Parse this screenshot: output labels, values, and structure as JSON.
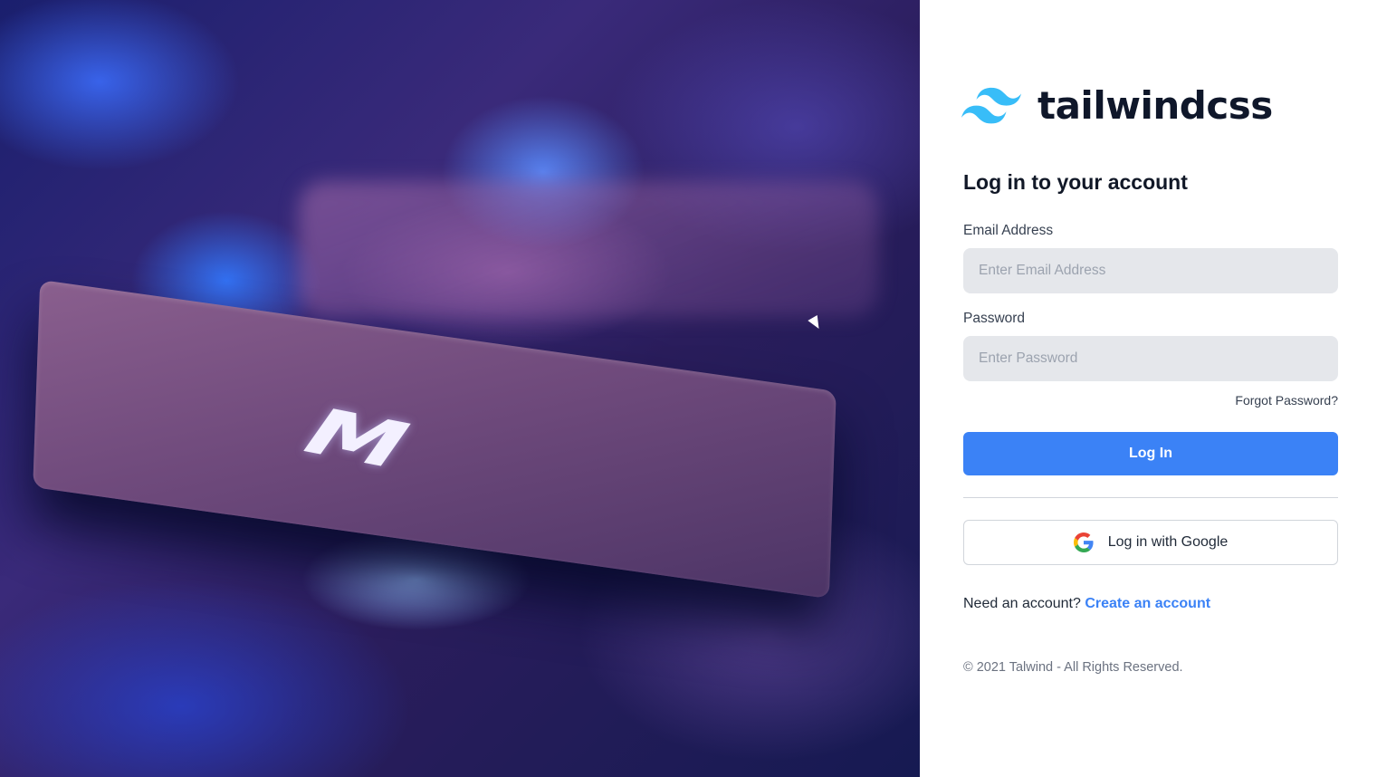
{
  "brand": {
    "name": "tailwindcss",
    "accent": "#38bdf8"
  },
  "hero": {
    "key_letter": "M"
  },
  "form": {
    "title": "Log in to your account",
    "email": {
      "label": "Email Address",
      "placeholder": "Enter Email Address",
      "value": ""
    },
    "password": {
      "label": "Password",
      "placeholder": "Enter Password",
      "value": ""
    },
    "forgot_label": "Forgot Password?",
    "login_label": "Log In",
    "google_label": "Log in with Google",
    "signup_prompt": "Need an account?",
    "signup_link": "Create an account"
  },
  "footer": {
    "copyright": "© 2021 Talwind - All Rights Reserved."
  },
  "colors": {
    "primary": "#3b82f6",
    "input_bg": "#e5e7eb",
    "text": "#111827"
  },
  "icons": {
    "logo": "tailwind-wave-icon",
    "google": "google-g-icon",
    "cursor": "mouse-cursor-icon"
  }
}
